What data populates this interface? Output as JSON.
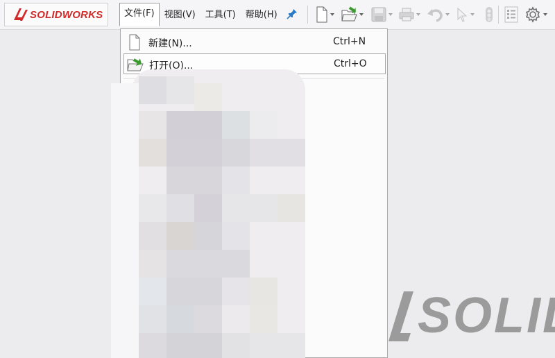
{
  "app": {
    "logo_text": "SOLIDWORKS"
  },
  "menubar": {
    "items": [
      {
        "label": "文件(F)",
        "active": true
      },
      {
        "label": "视图(V)",
        "active": false
      },
      {
        "label": "工具(T)",
        "active": false
      },
      {
        "label": "帮助(H)",
        "active": false
      }
    ]
  },
  "toolbar": {
    "icons": [
      "new-document-icon",
      "open-icon",
      "save-icon",
      "print-icon",
      "undo-icon",
      "select-icon",
      "rebuild-icon",
      "file-properties-icon",
      "options-gear-icon"
    ]
  },
  "file_menu": {
    "items": [
      {
        "label": "新建(N)...",
        "shortcut": "Ctrl+N",
        "icon": "new-document-icon"
      },
      {
        "label": "打开(O)...",
        "shortcut": "Ctrl+O",
        "icon": "open-folder-icon",
        "hover": true
      }
    ]
  },
  "background": {
    "watermark_text": "SOLID"
  },
  "colors": {
    "brand_red": "#d12a2a",
    "open_arrow_green": "#3a9a2e",
    "watermark_gray": "#9b9b9b"
  }
}
